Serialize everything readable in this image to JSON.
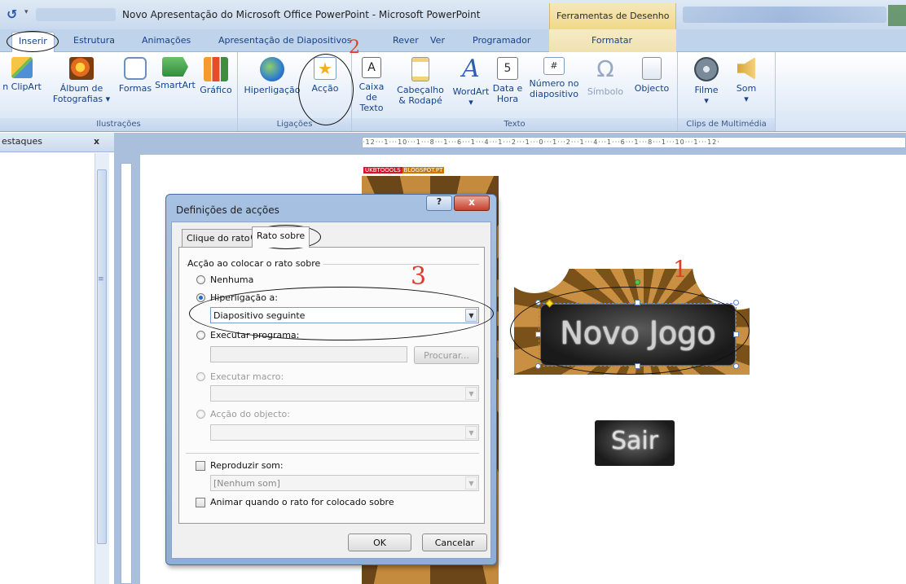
{
  "titlebar": {
    "title": "Novo Apresentação do Microsoft Office PowerPoint - Microsoft PowerPoint",
    "contextual_title": "Ferramentas de Desenho"
  },
  "tabs": [
    {
      "label": "Inserir",
      "active": true
    },
    {
      "label": "Estrutura"
    },
    {
      "label": "Animações"
    },
    {
      "label": "Apresentação de Diapositivos"
    },
    {
      "label": "Rever"
    },
    {
      "label": "Ver"
    },
    {
      "label": "Programador"
    },
    {
      "label": "Formatar"
    }
  ],
  "ribbon": {
    "groups": {
      "ilustracoes": "Ilustrações",
      "ligacoes": "Ligações",
      "texto": "Texto",
      "clips": "Clips de Multimédia"
    },
    "buttons": {
      "clipart": "n ClipArt",
      "album_1": "Álbum de",
      "album_2": "Fotografias ▾",
      "formas": "Formas",
      "smartart": "SmartArt",
      "grafico": "Gráfico",
      "hiperligacao": "Hiperligação",
      "accao": "Acção",
      "caixa_1": "Caixa",
      "caixa_2": "de Texto",
      "cabecalho_1": "Cabeçalho",
      "cabecalho_2": "& Rodapé",
      "wordart": "WordArt",
      "data_1": "Data e",
      "data_2": "Hora",
      "numero_1": "Número no",
      "numero_2": "diapositivo",
      "simbolo": "Símbolo",
      "objecto": "Objecto",
      "filme": "Filme",
      "som": "Som"
    }
  },
  "pane": {
    "tab_label": "estaques",
    "close": "x"
  },
  "ruler": {
    "top_text": "·12···1···10···1···8···1···6···1···4···1···2···1···0···1···2···1···4···1···6···1···8···1···10···1···12·"
  },
  "slide": {
    "watermark_a": "UKBTOOOLS",
    "watermark_b": "BLOGSPOT.PT",
    "novo_jogo": "Novo Jogo",
    "sair": "Sair"
  },
  "dialog": {
    "title": "Definições de acções",
    "help": "?",
    "close": "x",
    "tabs": [
      "Clique do rato",
      "Rato sobre"
    ],
    "section_label": "Acção ao colocar o rato sobre",
    "options": {
      "nenhuma": "Nenhuma",
      "hiperligacao": "Hiperligação a:",
      "executar_programa": "Executar programa:",
      "executar_macro": "Executar macro:",
      "accao_objecto": "Acção do objecto:"
    },
    "hyperlink_value": "Diapositivo seguinte",
    "procurar": "Procurar...",
    "reproduzir_som": "Reproduzir som:",
    "som_value": "[Nenhum som]",
    "animar": "Animar quando o rato for colocado sobre",
    "ok": "OK",
    "cancelar": "Cancelar"
  },
  "annotations": {
    "one": "1",
    "two": "2",
    "three": "3"
  },
  "colors": {
    "annotation": "#e23b2a",
    "ribbon_text": "#15428b"
  }
}
